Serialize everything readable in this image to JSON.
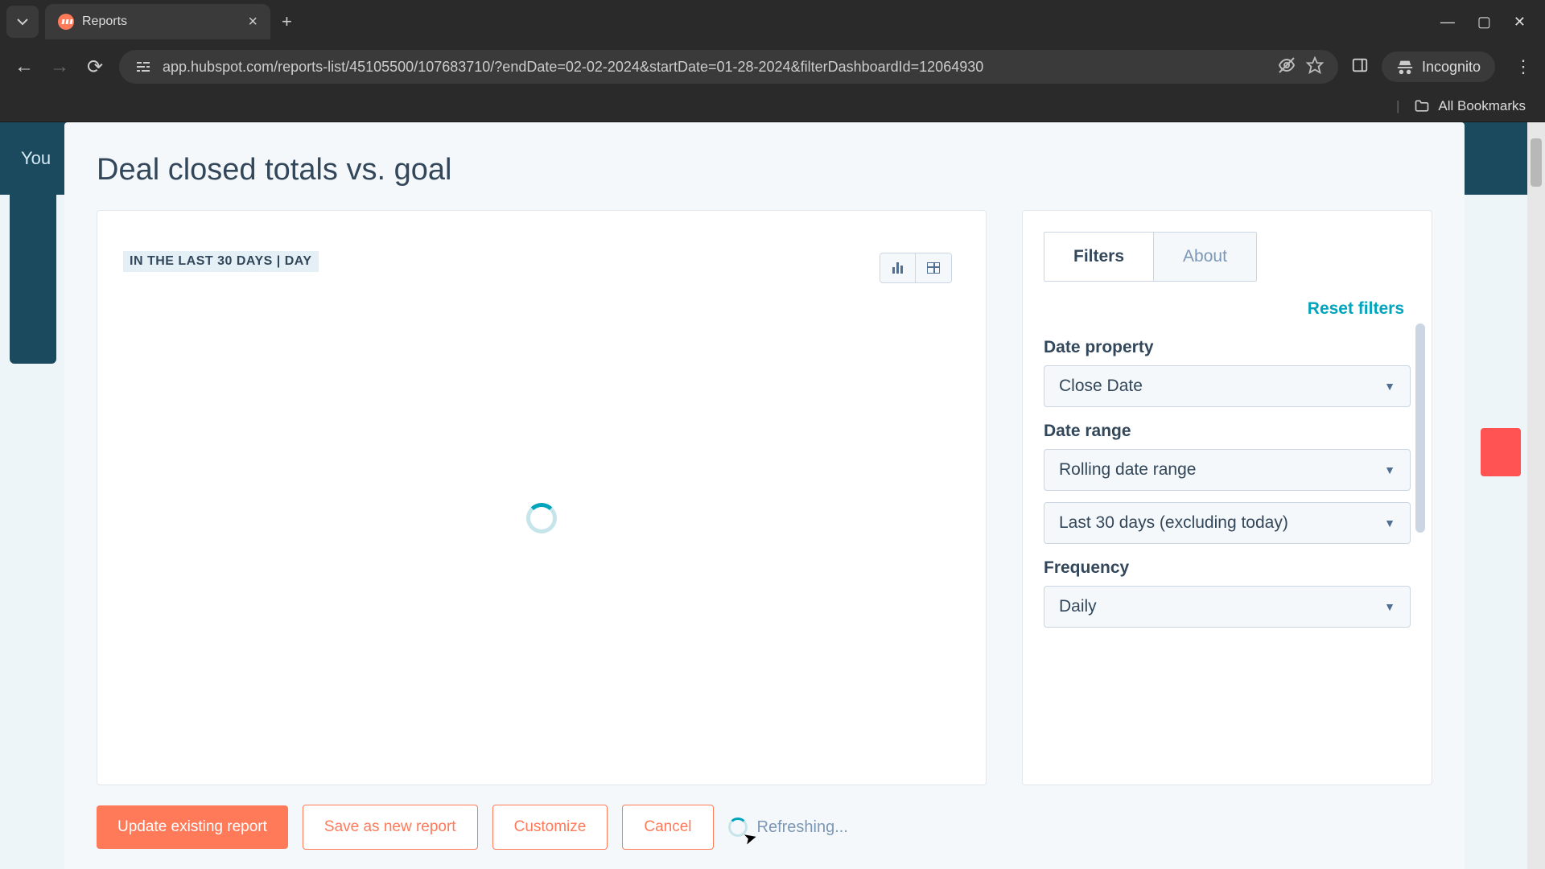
{
  "browser": {
    "tab_title": "Reports",
    "url": "app.hubspot.com/reports-list/45105500/107683710/?endDate=02-02-2024&startDate=01-28-2024&filterDashboardId=12064930",
    "incognito_label": "Incognito",
    "bookmarks_label": "All Bookmarks"
  },
  "bg": {
    "header_text": "You"
  },
  "modal": {
    "title": "Deal closed totals vs. goal",
    "chart_badge": "IN THE LAST 30 DAYS | DAY",
    "tabs": {
      "filters": "Filters",
      "about": "About"
    },
    "reset": "Reset filters",
    "fields": {
      "date_property": {
        "label": "Date property",
        "value": "Close Date"
      },
      "date_range": {
        "label": "Date range",
        "value": "Rolling date range",
        "sub_value": "Last 30 days (excluding today)"
      },
      "frequency": {
        "label": "Frequency",
        "value": "Daily"
      }
    },
    "footer": {
      "update": "Update existing report",
      "save_new": "Save as new report",
      "customize": "Customize",
      "cancel": "Cancel",
      "refreshing": "Refreshing..."
    }
  }
}
